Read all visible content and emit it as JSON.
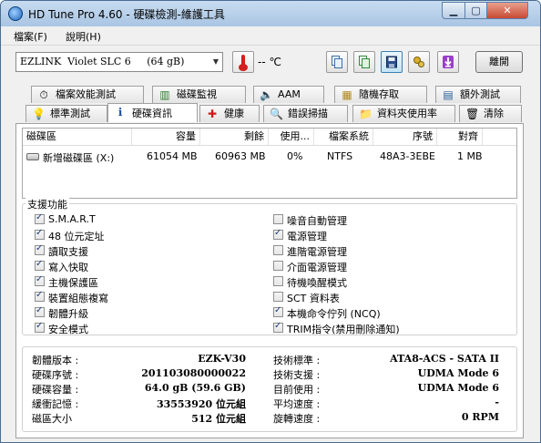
{
  "window": {
    "title": "HD Tune Pro 4.60 - 硬碟檢測-維護工具"
  },
  "menu": {
    "items": [
      "檔案(F)",
      "說明(H)"
    ]
  },
  "toolbar": {
    "drive_selected": "EZLINK  Violet SLC 6     (64 gB)",
    "temperature": "-- ℃",
    "exit_label": "離開",
    "buttons": [
      {
        "icon": "copy-icon"
      },
      {
        "icon": "copy-screenshot-icon"
      },
      {
        "icon": "save-icon"
      },
      {
        "icon": "options-icon"
      },
      {
        "icon": "download-icon"
      }
    ]
  },
  "tabs_row1": [
    "檔案效能測試",
    "磁碟監視",
    "AAM",
    "隨機存取",
    "額外測試"
  ],
  "tabs_row2": [
    "標準測試",
    "硬碟資訊",
    "健康",
    "錯誤掃描",
    "資料夾使用率",
    "清除"
  ],
  "active_tab": "硬碟資訊",
  "partitions": {
    "headers": [
      "磁碟區",
      "容量",
      "剩餘",
      "使用...",
      "檔案系統",
      "序號",
      "對齊"
    ],
    "rows": [
      [
        "新增磁碟區 (X:)",
        "61054 MB",
        "60963 MB",
        "0%",
        "NTFS",
        "48A3-3EBE",
        "1 MB"
      ]
    ]
  },
  "features": {
    "label": "支援功能",
    "left": [
      {
        "label": "S.M.A.R.T",
        "checked": true
      },
      {
        "label": "48 位元定址",
        "checked": true
      },
      {
        "label": "讀取支援",
        "checked": true
      },
      {
        "label": "寫入快取",
        "checked": true
      },
      {
        "label": "主機保護區",
        "checked": true
      },
      {
        "label": "裝置組態複寫",
        "checked": true
      },
      {
        "label": "韌體升級",
        "checked": true
      },
      {
        "label": "安全模式",
        "checked": true
      }
    ],
    "right": [
      {
        "label": "噪音自動管理",
        "checked": false
      },
      {
        "label": "電源管理",
        "checked": true
      },
      {
        "label": "進階電源管理",
        "checked": false
      },
      {
        "label": "介面電源管理",
        "checked": false
      },
      {
        "label": "待機喚醒模式",
        "checked": false
      },
      {
        "label": "SCT 資料表",
        "checked": false
      },
      {
        "label": "本機命令佇列 (NCQ)",
        "checked": true
      },
      {
        "label": "TRIM指令(禁用刪除通知)",
        "checked": true
      }
    ]
  },
  "info": {
    "left": [
      {
        "label": "韌體版本 :",
        "value": "EZK-V30"
      },
      {
        "label": "硬碟序號 :",
        "value": "201103080000022"
      },
      {
        "label": "硬碟容量 :",
        "value": "64.0 gB (59.6 GB)"
      },
      {
        "label": "緩衝記憶 :",
        "value": "33553920 位元組"
      },
      {
        "label": "磁區大小",
        "value": "512 位元組"
      }
    ],
    "right": [
      {
        "label": "技術標準 :",
        "value": "ATA8-ACS - SATA II"
      },
      {
        "label": "技術支援 :",
        "value": "UDMA Mode 6"
      },
      {
        "label": "目前使用 :",
        "value": "UDMA Mode 6"
      },
      {
        "label": "平均速度 :",
        "value": "-"
      },
      {
        "label": "旋轉速度 :",
        "value": "0 RPM"
      }
    ]
  }
}
